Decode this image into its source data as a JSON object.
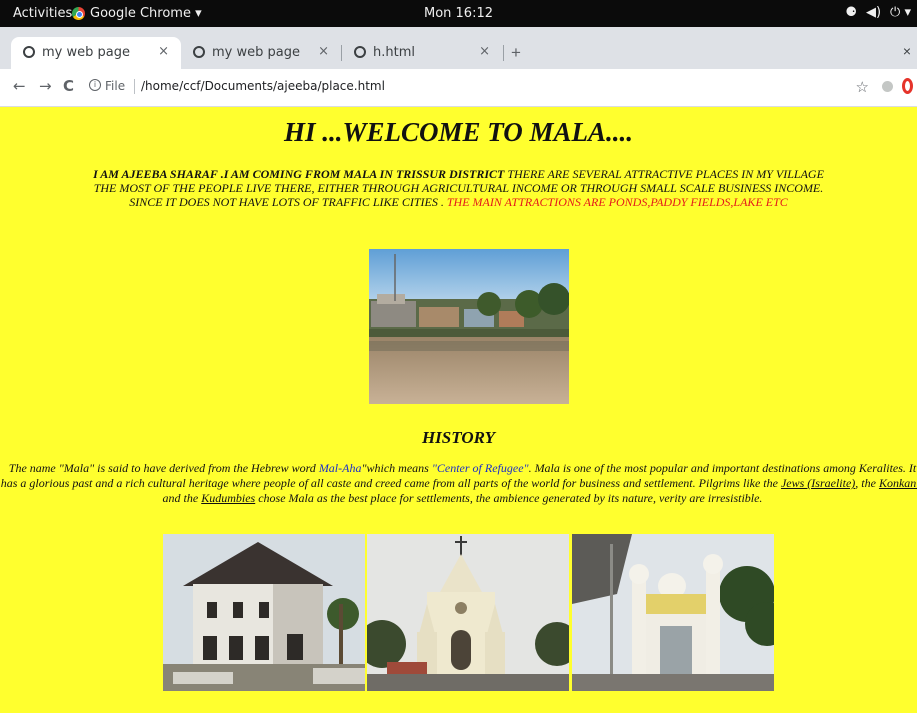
{
  "topbar": {
    "activities": "Activities",
    "app_name": "Google Chrome ▾",
    "clock": "Mon 16:12",
    "tray": [
      "⚈",
      "◀)",
      "⏻ ▾"
    ]
  },
  "tabs": [
    {
      "title": "my web page",
      "close": "×"
    },
    {
      "title": "my web page",
      "close": "×"
    },
    {
      "title": "h.html",
      "close": "×"
    }
  ],
  "new_tab": "+",
  "window_close": "×",
  "toolbar": {
    "back": "←",
    "forward": "→",
    "reload": "C",
    "info": "i",
    "file_label": "File",
    "url": "/home/ccf/Documents/ajeeba/place.html",
    "star": "☆"
  },
  "page": {
    "title": "HI ...WELCOME TO MALA....",
    "intro": {
      "bold": "I AM AJEEBA SHARAF .I AM COMING FROM MALA IN TRISSUR DISTRICT",
      "line1_rest": " THERE ARE SEVERAL ATTRACTIVE PLACES IN MY VILLAGE",
      "line2": "THE MOST OF THE PEOPLE LIVE THERE, EITHER THROUGH AGRICULTURAL INCOME OR THROUGH SMALL SCALE BUSINESS INCOME.",
      "line3": "SINCE IT DOES NOT HAVE LOTS OF TRAFFIC LIKE CITIES . ",
      "red": "THE MAIN ATTRACTIONS ARE PONDS,PADDY FIELDS,LAKE ETC"
    },
    "history_heading": "HISTORY",
    "history": {
      "p1": "The name \"Mala\" is said to have derived from the Hebrew word ",
      "mal_aha": "Mal-Aha",
      "p2": "\"which means ",
      "center": "\"Center of Refugee\"",
      "p3": ". Mala is one of the most popular and important destinations among Keralites. It has a glorious past and a rich cultural heritage where people of all caste and creed came from all parts of the world for business and settlement. Pilgrims like the ",
      "jews": "Jews (Israelite)",
      "p4": ", the ",
      "konkanis": "Konkanis",
      "p5": " and the ",
      "kudumbies": "Kudumbies",
      "p6": " chose Mala as the best place for settlements, the ambience generated by its nature, verity are irresistible."
    }
  },
  "colors": {
    "page_bg": "#ffff2e",
    "red_text": "#e41b1b",
    "blue_text": "#1a2ec7"
  }
}
